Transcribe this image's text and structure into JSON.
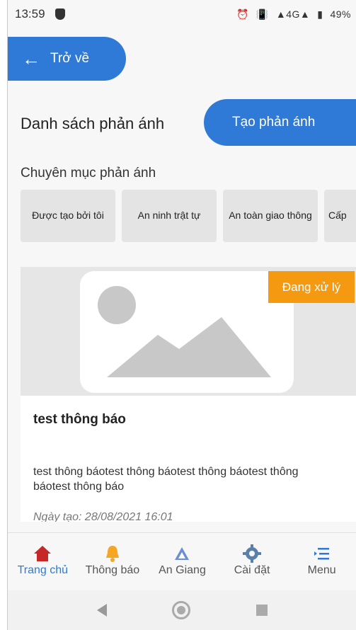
{
  "status_bar": {
    "time": "13:59",
    "signal": "4G",
    "battery": "49%"
  },
  "header": {
    "back_label": "Trở về"
  },
  "page": {
    "title": "Danh sách phản ánh",
    "create_label": "Tạo phản ánh"
  },
  "categories": {
    "label": "Chuyên mục phản ánh",
    "items": [
      {
        "label": "Được tạo bởi tôi"
      },
      {
        "label": "An ninh trật tự"
      },
      {
        "label": "An toàn giao thông"
      },
      {
        "label": "Cấp"
      }
    ]
  },
  "card": {
    "status": "Đang xử lý",
    "status_color": "#f59a10",
    "title": "test thông báo",
    "description": "test thông báotest thông báotest thông báotest thông báotest thông báo",
    "date": "Ngày tạo: 28/08/2021 16:01"
  },
  "bottom_nav": {
    "items": [
      {
        "label": "Trang chủ",
        "icon": "home-icon"
      },
      {
        "label": "Thông báo",
        "icon": "bell-icon"
      },
      {
        "label": "An Giang",
        "icon": "logo-icon"
      },
      {
        "label": "Cài đặt",
        "icon": "gear-icon"
      },
      {
        "label": "Menu",
        "icon": "menu-icon"
      }
    ]
  },
  "colors": {
    "primary": "#2f7ad6",
    "active_nav": "#2f7ad6",
    "home_icon": "#c62828",
    "bell_icon": "#f5a623"
  }
}
